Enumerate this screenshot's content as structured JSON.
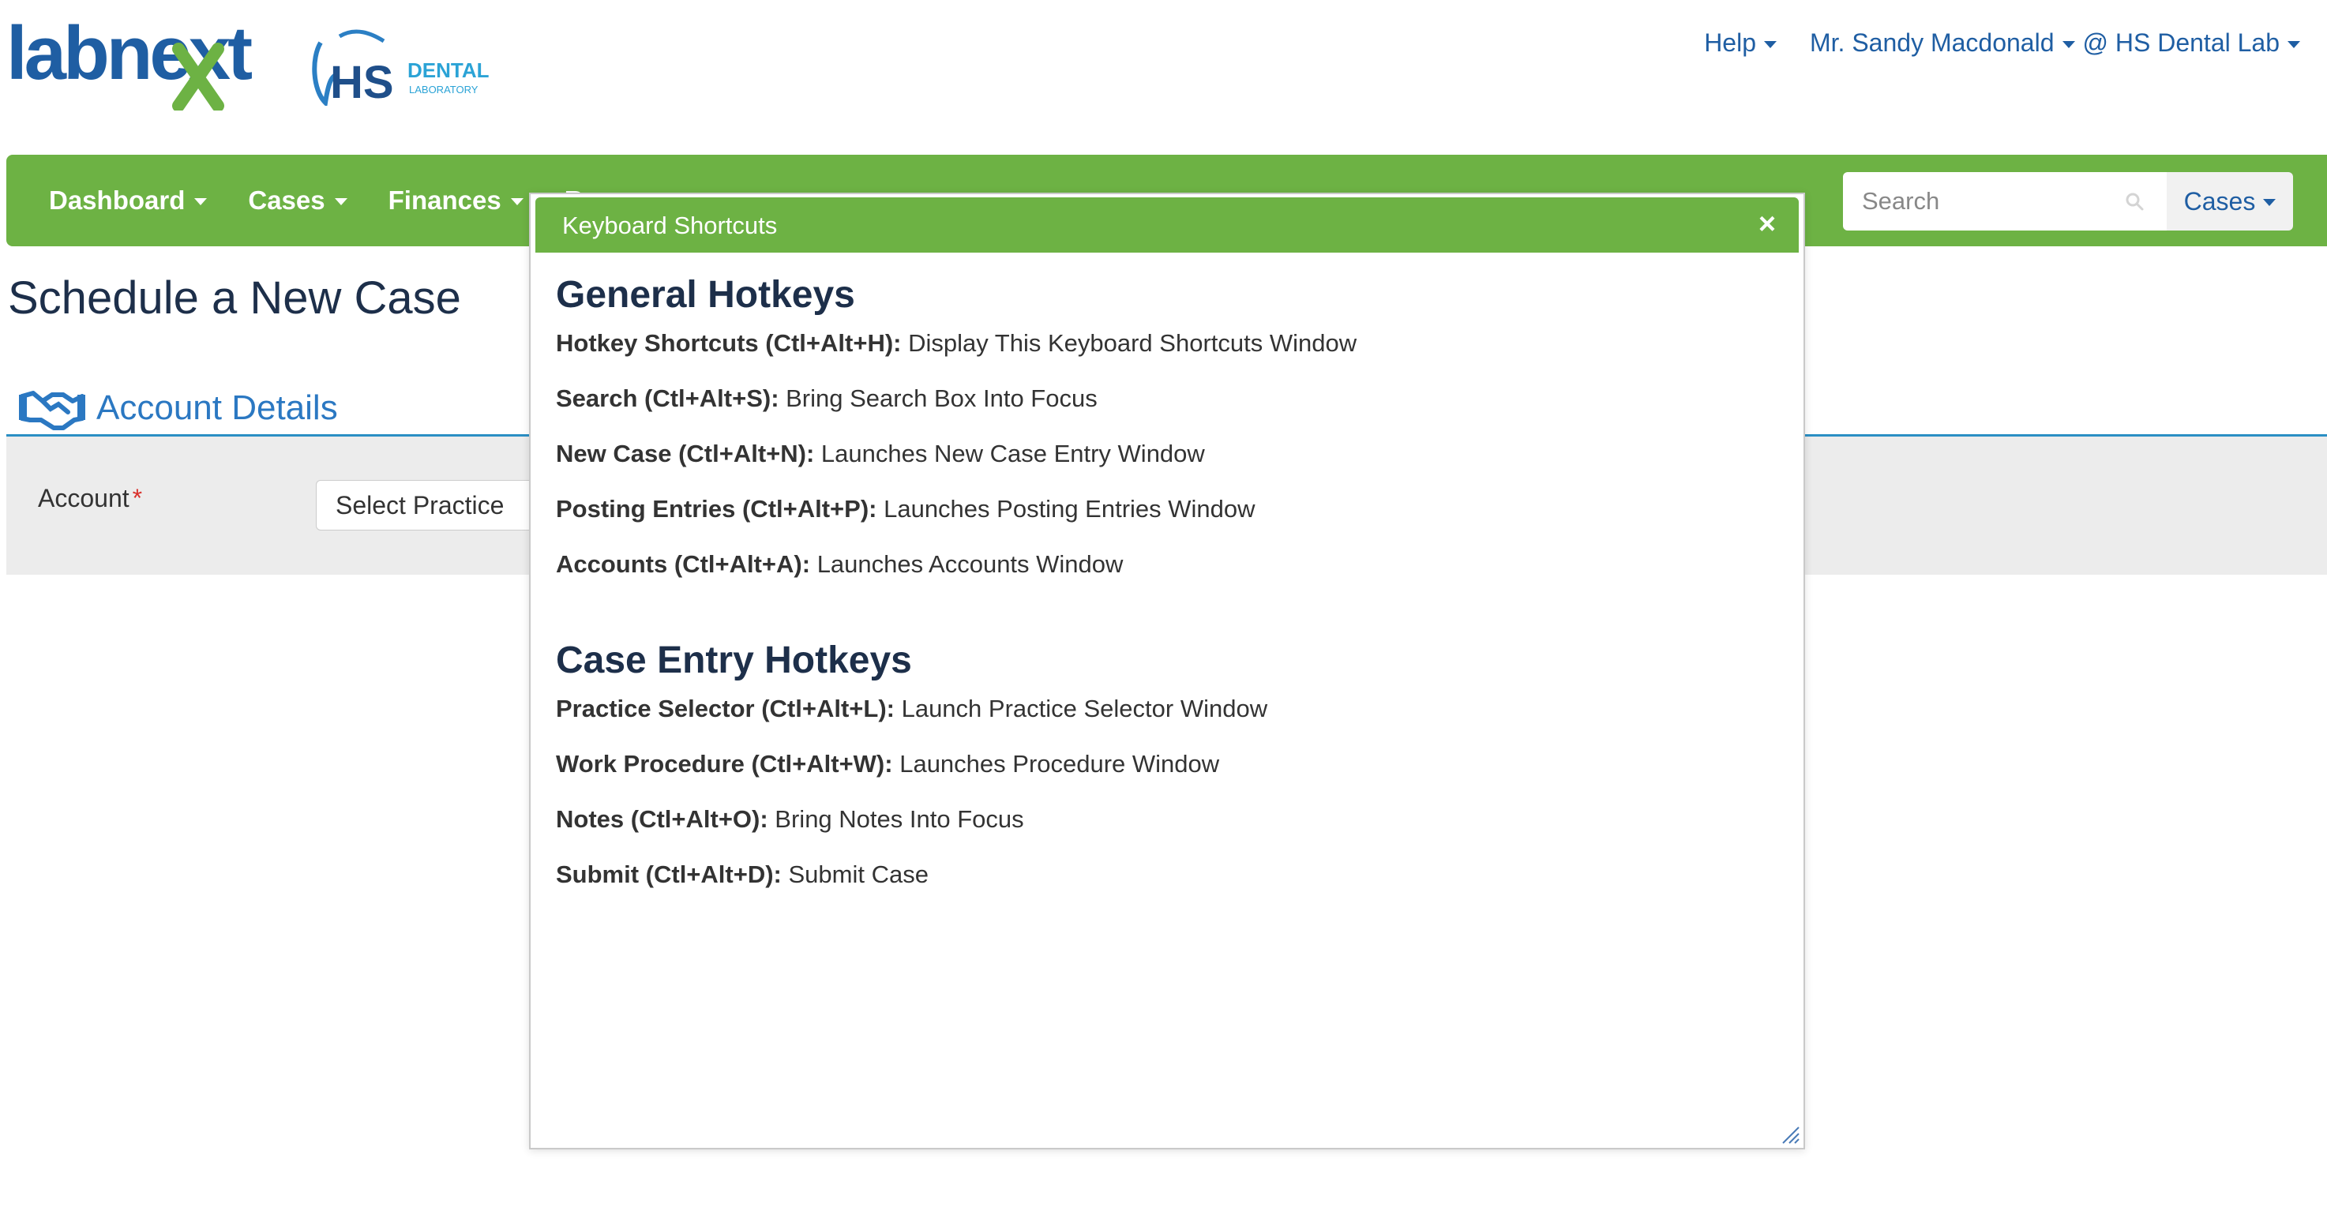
{
  "brand": {
    "labnext_wordmark": "labnext",
    "hs_letters": "HS",
    "hs_text_1": "DENTAL",
    "hs_text_2": "LABORATORY"
  },
  "top_links": {
    "help": "Help",
    "user": "Mr. Sandy Macdonald",
    "lab": "@ HS Dental Lab"
  },
  "nav": {
    "items": [
      {
        "label": "Dashboard"
      },
      {
        "label": "Cases"
      },
      {
        "label": "Finances"
      },
      {
        "label": "R"
      }
    ],
    "search_placeholder": "Search",
    "search_scope": "Cases"
  },
  "page": {
    "title": "Schedule a New Case",
    "section_title": "Account Details",
    "account_label": "Account",
    "required_mark": "*",
    "select_placeholder": "Select Practice"
  },
  "modal": {
    "title": "Keyboard Shortcuts",
    "close_glyph": "×",
    "groups": [
      {
        "title": "General Hotkeys",
        "items": [
          {
            "key": "Hotkey Shortcuts (Ctl+Alt+H):",
            "desc": " Display This Keyboard Shortcuts Window"
          },
          {
            "key": "Search (Ctl+Alt+S):",
            "desc": " Bring Search Box Into Focus"
          },
          {
            "key": "New Case (Ctl+Alt+N):",
            "desc": " Launches New Case Entry Window"
          },
          {
            "key": "Posting Entries (Ctl+Alt+P):",
            "desc": " Launches Posting Entries Window"
          },
          {
            "key": "Accounts (Ctl+Alt+A):",
            "desc": " Launches Accounts Window"
          }
        ]
      },
      {
        "title": "Case Entry Hotkeys",
        "items": [
          {
            "key": "Practice Selector (Ctl+Alt+L):",
            "desc": " Launch Practice Selector Window"
          },
          {
            "key": "Work Procedure (Ctl+Alt+W):",
            "desc": " Launches Procedure Window"
          },
          {
            "key": "Notes (Ctl+Alt+O):",
            "desc": " Bring Notes Into Focus"
          },
          {
            "key": "Submit (Ctl+Alt+D):",
            "desc": " Submit Case"
          }
        ]
      }
    ]
  },
  "colors": {
    "brand_green": "#6db244",
    "link_blue": "#1f5ea3",
    "heading_navy": "#1d2f4a",
    "section_blue": "#2b78c2",
    "required_red": "#d9302b"
  },
  "icons": [
    "search-icon",
    "handshake-icon",
    "close-icon",
    "chevron-down-icon",
    "resize-grip-icon"
  ]
}
